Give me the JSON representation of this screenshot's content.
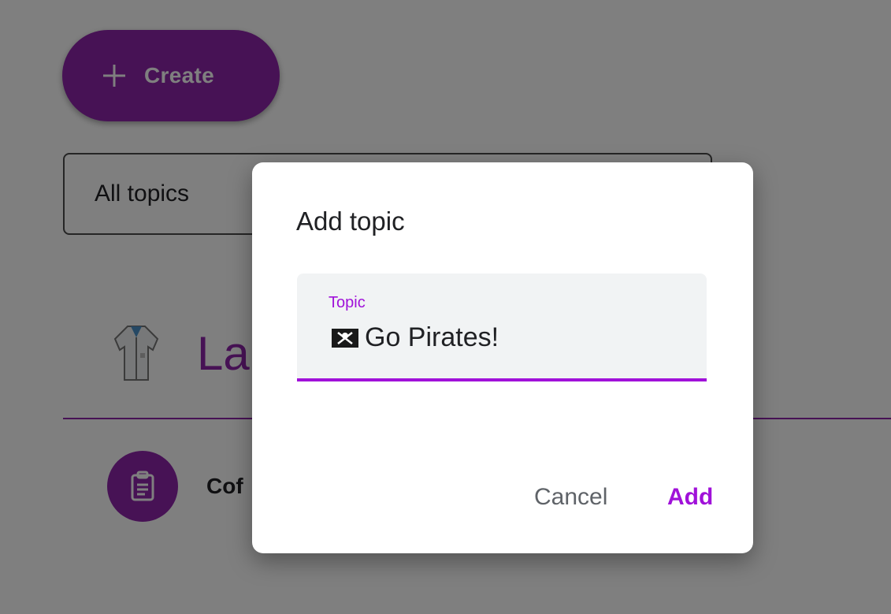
{
  "colors": {
    "primary": "#8e24aa",
    "create_button_bg": "#8e24aa",
    "accent": "#a011d9",
    "scrim": "rgba(0,0,0,0.5)",
    "dialog_bg": "#ffffff",
    "field_bg": "#f1f3f4"
  },
  "header": {
    "create_button": {
      "label": "Create",
      "icon": "plus-icon"
    }
  },
  "filter": {
    "selected": "All topics"
  },
  "class": {
    "title_visible": "La",
    "icon": "lab-coat-icon"
  },
  "assignment": {
    "icon": "clipboard-icon",
    "label_visible": "Cof"
  },
  "dialog": {
    "title": "Add topic",
    "field": {
      "label": "Topic",
      "icon": "pirate-flag-emoji",
      "value": "Go Pirates!"
    },
    "actions": {
      "cancel": "Cancel",
      "add": "Add"
    }
  }
}
